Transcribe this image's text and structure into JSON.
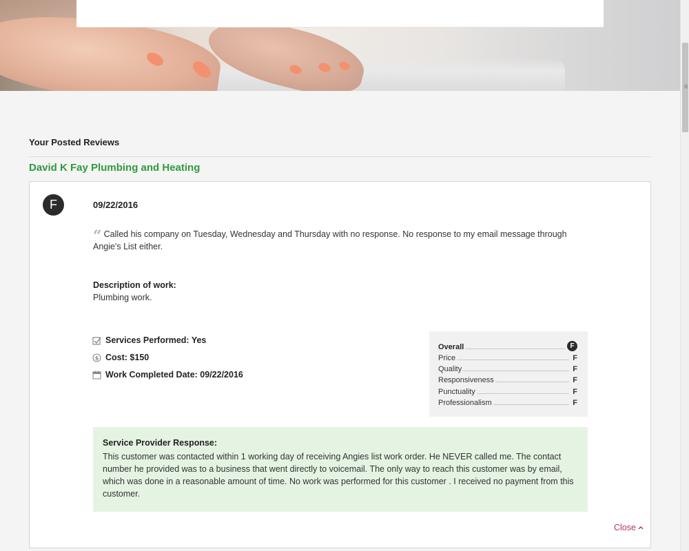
{
  "page": {
    "section_title": "Your Posted Reviews",
    "provider_name": "David K Fay Plumbing and Heating"
  },
  "review": {
    "grade": "F",
    "date": "09/22/2016",
    "comment": "Called his company on Tuesday, Wednesday and Thursday with no response. No response to my email message through Angie's List either.",
    "description_label": "Description of work:",
    "description_value": "Plumbing work.",
    "facts": [
      {
        "icon": "checkbox-icon",
        "text": "Services Performed: Yes"
      },
      {
        "icon": "dollar-icon",
        "text": "Cost: $150"
      },
      {
        "icon": "calendar-icon",
        "text": "Work Completed Date: 09/22/2016"
      }
    ],
    "ratings": [
      {
        "label": "Overall",
        "grade": "F"
      },
      {
        "label": "Price",
        "grade": "F"
      },
      {
        "label": "Quality",
        "grade": "F"
      },
      {
        "label": "Responsiveness",
        "grade": "F"
      },
      {
        "label": "Punctuality",
        "grade": "F"
      },
      {
        "label": "Professionalism",
        "grade": "F"
      }
    ],
    "response_label": "Service Provider Response:",
    "response_text": "This customer was contacted within 1 working day of receiving Angies list work order. He NEVER called me. The contact number he provided was to a business that went directly to voicemail. The only way to reach this customer was by email, which was done in a reasonable amount of time. No work was performed for this customer . I received no payment from this customer.",
    "close_label": "Close"
  },
  "colors": {
    "provider_green": "#2e9a3e",
    "close_link": "#b03a5b",
    "response_bg": "#e5f3e3",
    "badge_dark": "#2b2b2b"
  }
}
